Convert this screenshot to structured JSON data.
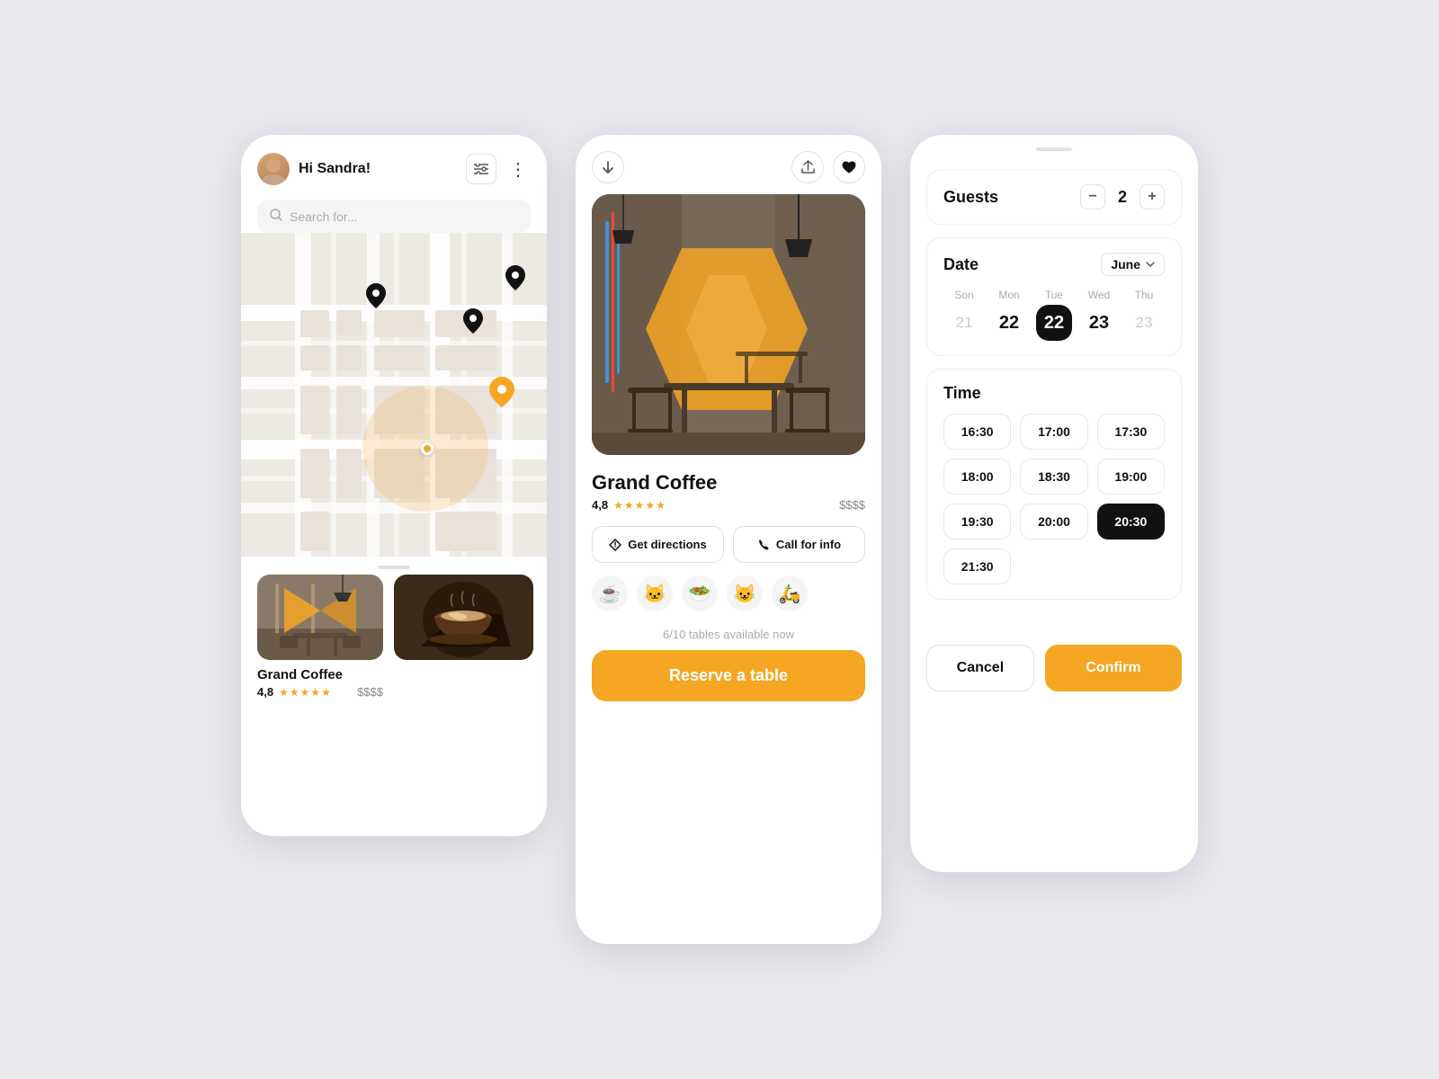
{
  "screen1": {
    "greeting": "Hi Sandra!",
    "search_placeholder": "Search for...",
    "restaurant_card1": {
      "name": "Grand Coffee",
      "rating": "4,8",
      "price": "$$$$"
    }
  },
  "screen2": {
    "restaurant_name": "Grand Coffee",
    "rating": "4,8",
    "price": "$$$$",
    "get_directions_label": "Get directions",
    "call_for_info_label": "Call for info",
    "availability": "6/10 tables available now",
    "reserve_label": "Reserve a table",
    "emojis": [
      "☕",
      "🐱",
      "🥗",
      "😺",
      "🛵"
    ]
  },
  "screen3": {
    "guests_label": "Guests",
    "guest_count": "2",
    "minus_label": "−",
    "plus_label": "+",
    "date_label": "Date",
    "month": "June",
    "days": [
      {
        "label": "Son",
        "num": "21",
        "type": "light"
      },
      {
        "label": "Mon",
        "num": "22",
        "type": "normal"
      },
      {
        "label": "Tue",
        "num": "22",
        "type": "selected"
      },
      {
        "label": "Wed",
        "num": "23",
        "type": "normal"
      },
      {
        "label": "Thu",
        "num": "23",
        "type": "light"
      }
    ],
    "time_label": "Time",
    "time_slots": [
      {
        "time": "16:30",
        "selected": false
      },
      {
        "time": "17:00",
        "selected": false
      },
      {
        "time": "17:30",
        "selected": false
      },
      {
        "time": "18:00",
        "selected": false
      },
      {
        "time": "18:30",
        "selected": false
      },
      {
        "time": "19:00",
        "selected": false
      },
      {
        "time": "19:30",
        "selected": false
      },
      {
        "time": "20:00",
        "selected": false
      },
      {
        "time": "20:30",
        "selected": true
      },
      {
        "time": "21:30",
        "selected": false
      }
    ],
    "cancel_label": "Cancel",
    "confirm_label": "Confirm"
  }
}
